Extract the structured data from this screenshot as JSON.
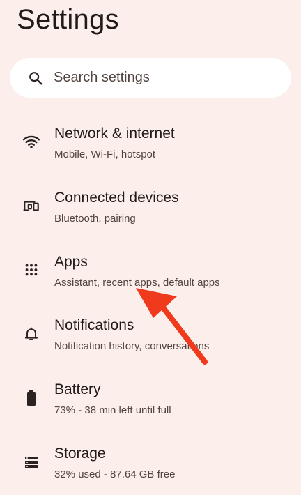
{
  "header": {
    "title": "Settings"
  },
  "search": {
    "placeholder": "Search settings",
    "icon": "search-icon"
  },
  "settings": [
    {
      "id": "network",
      "icon": "wifi-icon",
      "title": "Network & internet",
      "subtitle": "Mobile, Wi-Fi, hotspot"
    },
    {
      "id": "connected-devices",
      "icon": "connected-devices-icon",
      "title": "Connected devices",
      "subtitle": "Bluetooth, pairing"
    },
    {
      "id": "apps",
      "icon": "apps-grid-icon",
      "title": "Apps",
      "subtitle": "Assistant, recent apps, default apps"
    },
    {
      "id": "notifications",
      "icon": "bell-icon",
      "title": "Notifications",
      "subtitle": "Notification history, conversations"
    },
    {
      "id": "battery",
      "icon": "battery-icon",
      "title": "Battery",
      "subtitle": "73% - 38 min left until full"
    },
    {
      "id": "storage",
      "icon": "storage-icon",
      "title": "Storage",
      "subtitle": "32% used - 87.64 GB free"
    }
  ],
  "annotation": {
    "color": "#f03a1e",
    "icon": "annotation-arrow-icon"
  }
}
